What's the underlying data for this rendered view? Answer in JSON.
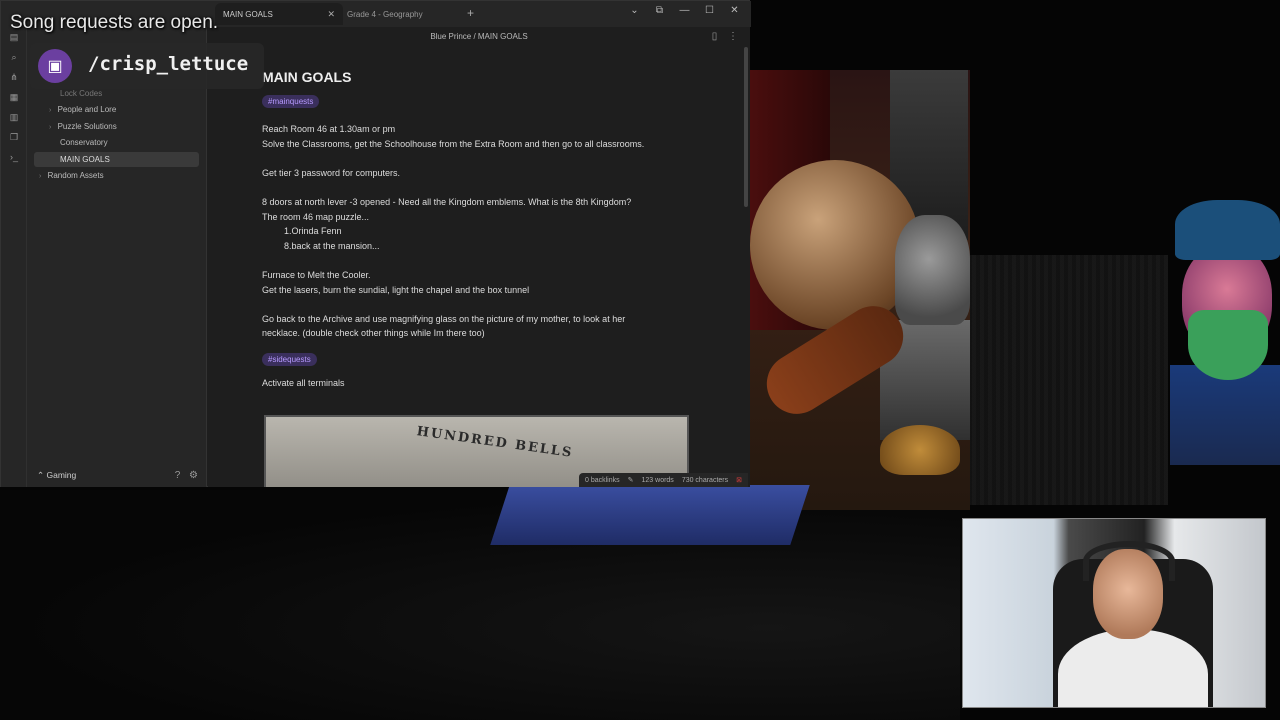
{
  "overlay": {
    "song_requests": "Song requests are open.",
    "twitch_handle": "/crisp_lettuce"
  },
  "window": {
    "tabs": [
      {
        "label": "MAIN GOALS",
        "active": true
      },
      {
        "label": "Grade 4 - Geography",
        "active": false
      }
    ],
    "new_tab_symbol": "+",
    "controls": [
      "⌄",
      "⧉",
      "—",
      "☐",
      "✕"
    ]
  },
  "sidebar": {
    "items": [
      {
        "label": "Lock Codes",
        "chevron": ""
      },
      {
        "label": "People and Lore",
        "chevron": "›"
      },
      {
        "label": "Puzzle Solutions",
        "chevron": "›"
      },
      {
        "label": "Conservatory",
        "chevron": ""
      },
      {
        "label": "MAIN GOALS",
        "chevron": "",
        "active": true
      },
      {
        "label": "Random Assets",
        "chevron": "›"
      }
    ],
    "vault_name": "Gaming",
    "vault_icon": "⌃"
  },
  "editor": {
    "breadcrumb": "Blue Prince  /  MAIN GOALS",
    "title": "MAIN GOALS",
    "tag_main": "#mainquests",
    "lines": [
      "Reach Room 46 at 1.30am or pm",
      "Solve the Classrooms, get the Schoolhouse from the Extra Room and then go to all classrooms.",
      "Get tier 3 password for computers.",
      "8 doors at north lever -3 opened - Need all the Kingdom emblems. What is the 8th Kingdom?",
      "The room 46 map puzzle...",
      "1.Orinda Fenn",
      "8.back at the mansion...",
      "Furnace to Melt the Cooler.",
      "Get the lasers, burn the sundial, light the chapel and the box tunnel",
      "Go back to the Archive and use magnifying glass on the picture of my mother, to look at her",
      "necklace. (double check other things while Im there too)",
      "Activate all terminals"
    ],
    "tag_side": "#sidequests",
    "image_text": "HUNDRED BELLS"
  },
  "statusbar": {
    "backlinks": "0 backlinks",
    "words": "123 words",
    "characters": "730 characters"
  }
}
